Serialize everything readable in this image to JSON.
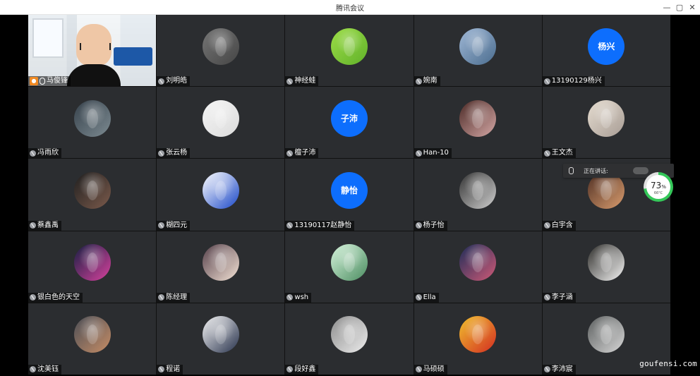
{
  "window": {
    "title": "腾讯会议",
    "buttons": [
      "—",
      "▢",
      "✕"
    ]
  },
  "participants": [
    {
      "name": "马俊锋",
      "kind": "video",
      "icon": "host-video"
    },
    {
      "name": "刘明皓",
      "kind": "pic",
      "avatar": "p1"
    },
    {
      "name": "神经蛙",
      "kind": "pic",
      "avatar": "p2"
    },
    {
      "name": "婉南",
      "kind": "pic",
      "avatar": "p3"
    },
    {
      "name": "13190129杨兴",
      "kind": "text",
      "avatar_text": "杨兴"
    },
    {
      "name": "冯雨欣",
      "kind": "pic",
      "avatar": "p4"
    },
    {
      "name": "张云杨",
      "kind": "pic",
      "avatar": "p5"
    },
    {
      "name": "檀子沛",
      "kind": "text",
      "avatar_text": "子沛"
    },
    {
      "name": "Han-10",
      "kind": "pic",
      "avatar": "p6"
    },
    {
      "name": "王文杰",
      "kind": "pic",
      "avatar": "p7"
    },
    {
      "name": "蔡鑫禹",
      "kind": "pic",
      "avatar": "p8"
    },
    {
      "name": "糊四元",
      "kind": "pic",
      "avatar": "p9"
    },
    {
      "name": "13190117赵静怡",
      "kind": "text",
      "avatar_text": "静怡"
    },
    {
      "name": "杨子怡",
      "kind": "pic",
      "avatar": "p10"
    },
    {
      "name": "白宇含",
      "kind": "pic",
      "avatar": "p11"
    },
    {
      "name": "银白色的天空",
      "kind": "pic",
      "avatar": "p12"
    },
    {
      "name": "陈经理",
      "kind": "pic",
      "avatar": "p13"
    },
    {
      "name": "wsh",
      "kind": "pic",
      "avatar": "p14"
    },
    {
      "name": "Ella",
      "kind": "pic",
      "avatar": "p15"
    },
    {
      "name": "李子涵",
      "kind": "pic",
      "avatar": "p16"
    },
    {
      "name": "沈美钰",
      "kind": "pic",
      "avatar": "p17"
    },
    {
      "name": "程诺",
      "kind": "pic",
      "avatar": "p18"
    },
    {
      "name": "段好鑫",
      "kind": "pic",
      "avatar": "p19"
    },
    {
      "name": "马硕硕",
      "kind": "pic",
      "avatar": "p20"
    },
    {
      "name": "李沛宸",
      "kind": "pic",
      "avatar": "p21"
    }
  ],
  "speaking": {
    "label": "正在讲话:"
  },
  "cpu_widget": {
    "percent": "73",
    "percent_suffix": "%",
    "temp": "66°C"
  },
  "watermark": "goufensi.com",
  "icons": {
    "muted": "muted-mic-icon",
    "host": "host-user-icon",
    "mic": "mic-icon",
    "minimize": "minimize-icon",
    "restore": "restore-icon",
    "close": "close-icon"
  }
}
